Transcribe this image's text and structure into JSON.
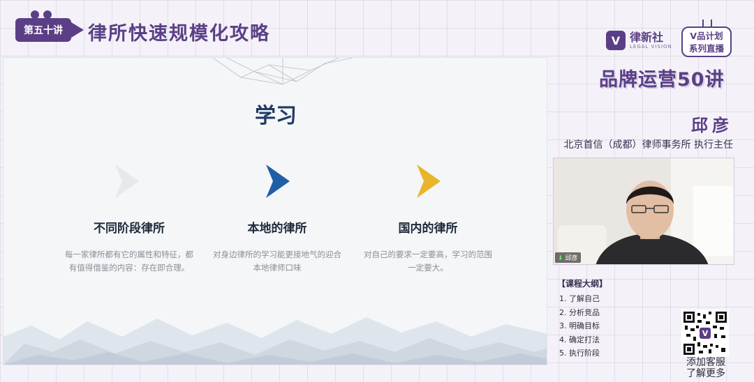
{
  "header": {
    "lecture_badge": "第五十讲",
    "series_title": "律所快速规模化攻略"
  },
  "brand": {
    "logo_glyph": "V",
    "name_cn": "律新社",
    "name_en": "LEGAL VISION",
    "live_line1": "V品计划",
    "live_line2": "系列直播",
    "program_title": "品牌运营50讲"
  },
  "speaker": {
    "name": "邱彦",
    "title": "北京首信（成都）律师事务所 执行主任",
    "video_tag": "邱彦"
  },
  "slide": {
    "title": "学习",
    "stages": [
      {
        "heading": "不同阶段律所",
        "desc": "每一家律所都有它的属性和特征，都有值得借鉴的内容：存在即合理。"
      },
      {
        "heading": "本地的律所",
        "desc": "对身边律所的学习能更接地气的迎合本地律师口味"
      },
      {
        "heading": "国内的律所",
        "desc": "对自己的要求一定要高，学习的范围一定要大。"
      }
    ],
    "colors": {
      "accent_blue": "#1f5fa6",
      "accent_gold": "#e8b52a",
      "title": "#1f3b63"
    }
  },
  "outline": {
    "heading": "【课程大纲】",
    "items": [
      "1. 了解自己",
      "2. 分析竞品",
      "3. 明确目标",
      "4. 确定打法",
      "5. 执行阶段"
    ]
  },
  "qr": {
    "caption_line1": "添加客服",
    "caption_line2": "了解更多"
  },
  "colors": {
    "brand_purple": "#5b3f86"
  }
}
